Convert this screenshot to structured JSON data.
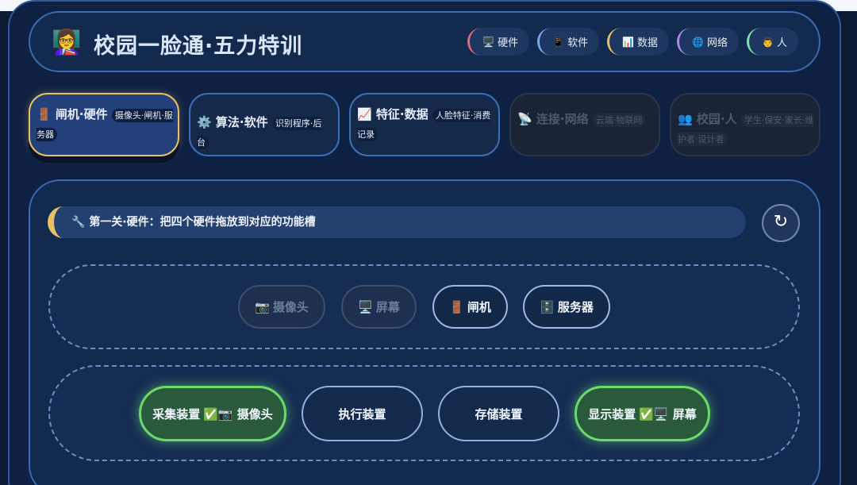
{
  "header": {
    "logo_icon": "teacher-emoji",
    "logo_glyph": "👩‍🏫",
    "title": "校园一脸通·五力特训",
    "chips": [
      {
        "icon": "🖥️",
        "label": "硬件",
        "color": "#e06a7d"
      },
      {
        "icon": "📱",
        "label": "软件",
        "color": "#7ea6ef"
      },
      {
        "icon": "📊",
        "label": "数据",
        "color": "#e8c164"
      },
      {
        "icon": "🌐",
        "label": "网络",
        "color": "#a98ae8"
      },
      {
        "icon": "👨",
        "label": "人",
        "color": "#7be3a3"
      }
    ]
  },
  "tabs": [
    {
      "icon": "🚪",
      "label": "闸机·硬件",
      "sub": "摄像头·闸机·服务器",
      "state": "active"
    },
    {
      "icon": "⚙️",
      "label": "算法·软件",
      "sub": "识别程序·后台",
      "state": "open"
    },
    {
      "icon": "📈",
      "label": "特征·数据",
      "sub": "人脸特征·消费记录",
      "state": "open"
    },
    {
      "icon": "📡",
      "label": "连接·网络",
      "sub": "云端·物联网",
      "state": "locked"
    },
    {
      "icon": "👥",
      "label": "校园·人",
      "sub": "学生·保安·家长·维护者·设计者",
      "state": "locked"
    }
  ],
  "mission": {
    "icon": "🔧",
    "text": "第一关·硬件：把四个硬件拖放到对应的功能槽"
  },
  "reset_glyph": "↻",
  "pieces": [
    {
      "icon": "📷",
      "label": "摄像头",
      "used": true
    },
    {
      "icon": "🖥️",
      "label": "屏幕",
      "used": true
    },
    {
      "icon": "🚪",
      "label": "闸机",
      "used": false
    },
    {
      "icon": "🗄️",
      "label": "服务器",
      "used": false
    }
  ],
  "slots": [
    {
      "label": "采集装置",
      "filled_with": "✅📷 摄像头"
    },
    {
      "label": "执行装置",
      "filled_with": ""
    },
    {
      "label": "存储装置",
      "filled_with": ""
    },
    {
      "label": "显示装置",
      "filled_with": "✅🖥️ 屏幕"
    }
  ]
}
